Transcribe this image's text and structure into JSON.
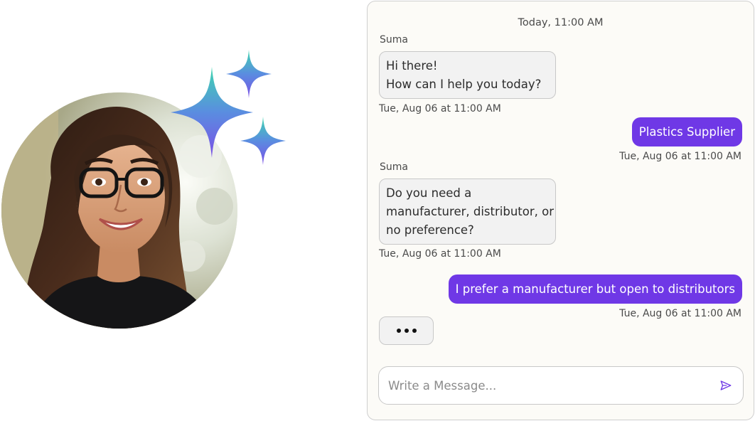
{
  "chat": {
    "date_header": "Today, 11:00 AM",
    "messages": [
      {
        "from": "bot",
        "sender": "Suma",
        "lines": [
          "Hi there!",
          "How can I help you today?"
        ],
        "timestamp": "Tue, Aug 06 at 11:00 AM"
      },
      {
        "from": "user",
        "text": "Plastics Supplier",
        "timestamp": "Tue, Aug 06 at 11:00 AM"
      },
      {
        "from": "bot",
        "sender": "Suma",
        "lines": [
          "Do you need a",
          "manufacturer, distributor, or",
          "no preference?"
        ],
        "timestamp": "Tue, Aug 06 at 11:00 AM"
      },
      {
        "from": "user",
        "text": "I prefer a manufacturer but open to distributors",
        "timestamp": "Tue, Aug 06 at 11:00 AM"
      }
    ],
    "typing_indicator": "•••",
    "composer": {
      "placeholder": "Write a Message...",
      "value": "",
      "send_icon": "send-icon"
    }
  },
  "colors": {
    "user_bubble": "#6f38e6",
    "bot_bubble": "#f2f2f2",
    "panel_bg": "#fcfbf7",
    "send_icon": "#6f38e6",
    "sparkle_gradient": [
      "#3fd6b0",
      "#5a8de0",
      "#7b4fe6"
    ]
  },
  "icons": [
    "sparkle-icon",
    "send-icon"
  ]
}
